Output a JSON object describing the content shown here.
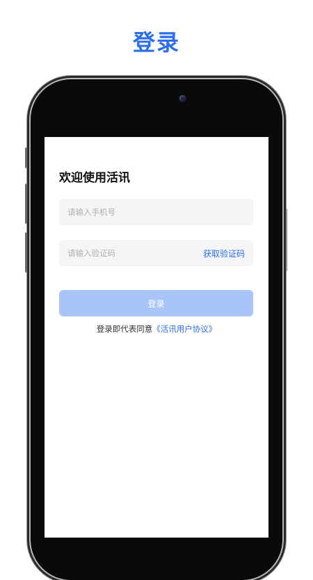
{
  "page": {
    "heading": "登录"
  },
  "colors": {
    "accent": "#2a6ef0",
    "button_disabled": "#a9c4f8",
    "field_bg": "#f5f5f7"
  },
  "device": {
    "frame": "phone-mockup"
  },
  "login": {
    "welcome": "欢迎使用活讯",
    "phone_placeholder": "请输入手机号",
    "code_placeholder": "请输入验证码",
    "get_code_label": "获取验证码",
    "submit_label": "登录",
    "agreement_prefix": "登录即代表同意",
    "agreement_link": "《活讯用户协议》"
  }
}
